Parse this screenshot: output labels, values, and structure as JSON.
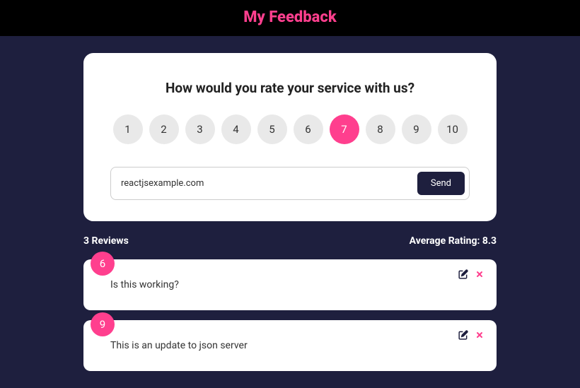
{
  "header": {
    "title": "My Feedback"
  },
  "form": {
    "question": "How would you rate your service with us?",
    "ratings": [
      "1",
      "2",
      "3",
      "4",
      "5",
      "6",
      "7",
      "8",
      "9",
      "10"
    ],
    "selected_rating": "7",
    "input_value": "reactjsexample.com",
    "send_label": "Send"
  },
  "stats": {
    "reviews_label": "3 Reviews",
    "average_label": "Average Rating: 8.3"
  },
  "reviews": [
    {
      "rating": "6",
      "text": "Is this working?"
    },
    {
      "rating": "9",
      "text": "This is an update to json server"
    }
  ],
  "icons": {
    "edit": "edit-icon",
    "close": "close-icon"
  },
  "colors": {
    "accent": "#ff3f8e",
    "background": "#1e1f3e"
  }
}
